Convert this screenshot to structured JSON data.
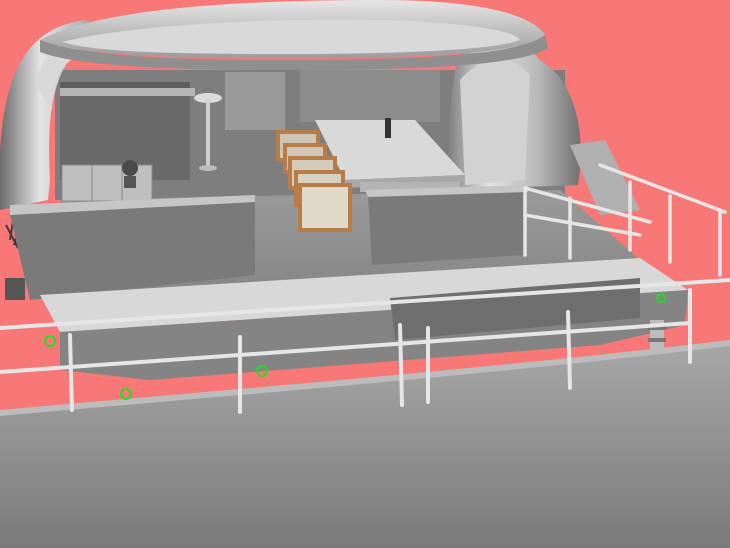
{
  "viewport": {
    "background": "#f87777",
    "shading_style": "grey-shaded-3d",
    "caption": ""
  },
  "scene": {
    "colors": {
      "hull": "#9a9a9a",
      "deck": "#8e8e8e",
      "hardtop": "#c8c8c8",
      "rail": "#e8e8e8",
      "chairs": "#b87c48",
      "snap_points": "#22dd22"
    },
    "snap_point_count": 4,
    "chair_count": 5
  }
}
